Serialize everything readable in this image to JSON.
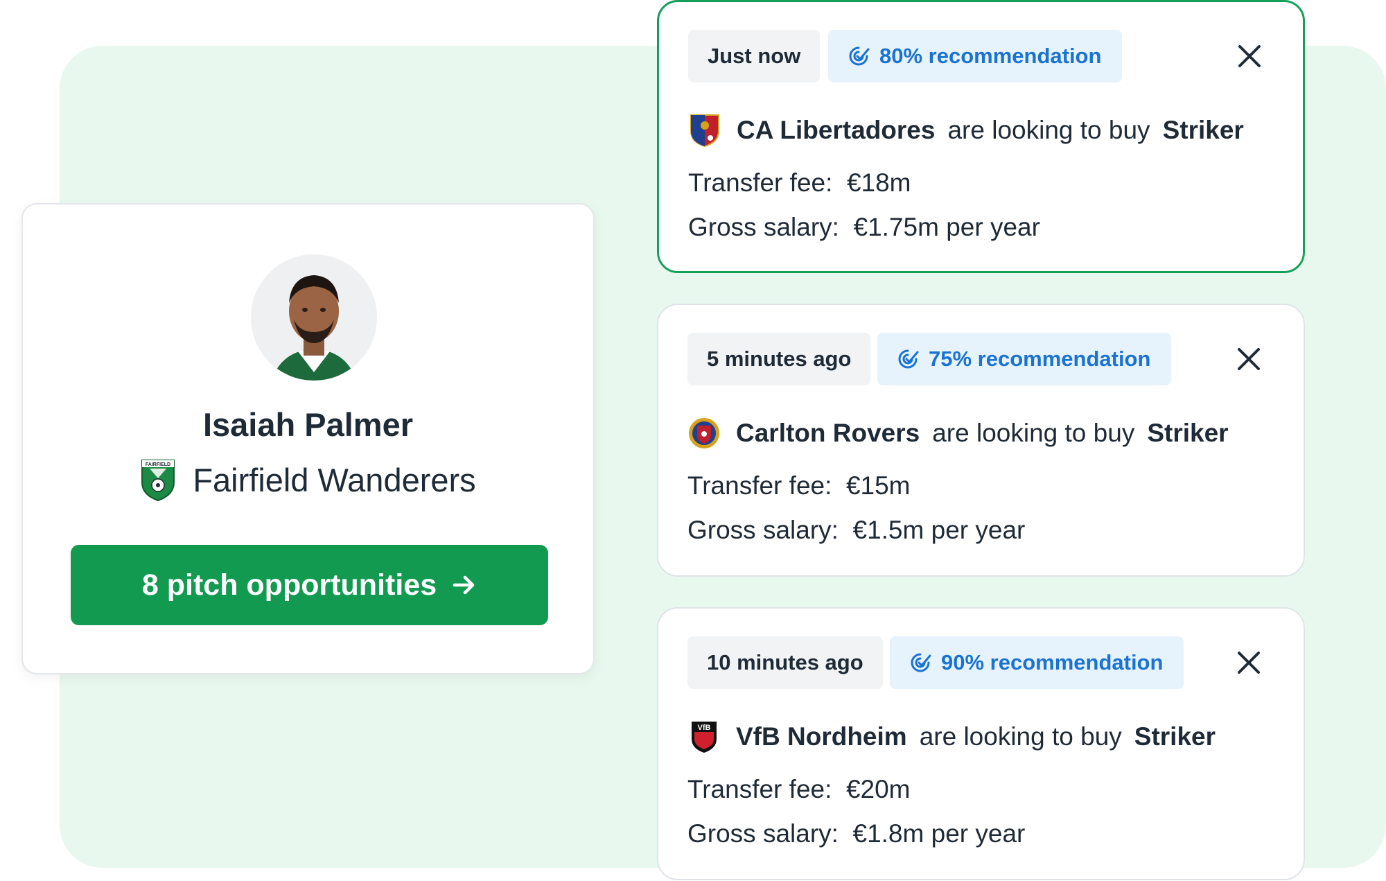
{
  "player": {
    "name": "Isaiah Palmer",
    "club": "Fairfield Wanderers",
    "crest_text": "FAIRFIELD",
    "cta_label": "8 pitch opportunities"
  },
  "opportunities": [
    {
      "time": "Just now",
      "recommendation": "80% recommendation",
      "team": "CA Libertadores",
      "verb": "are looking to buy",
      "position": "Striker",
      "fee_label": "Transfer fee:",
      "fee": "€18m",
      "salary_label": "Gross salary:",
      "salary": "€1.75m per year",
      "active": true
    },
    {
      "time": "5 minutes ago",
      "recommendation": "75% recommendation",
      "team": "Carlton Rovers",
      "verb": "are looking to buy",
      "position": "Striker",
      "fee_label": "Transfer fee:",
      "fee": "€15m",
      "salary_label": "Gross salary:",
      "salary": "€1.5m per year",
      "active": false
    },
    {
      "time": "10 minutes ago",
      "recommendation": "90% recommendation",
      "team": "VfB Nordheim",
      "verb": "are looking to buy",
      "position": "Striker",
      "fee_label": "Transfer fee:",
      "fee": "€20m",
      "salary_label": "Gross salary:",
      "salary": "€1.8m per year",
      "active": false,
      "crest_text": "VfB"
    }
  ],
  "colors": {
    "primary_green": "#119a50",
    "active_border": "#15a05a",
    "recommendation_blue": "#1a73d1",
    "background_panel": "#e8f8ee"
  },
  "icons": {
    "recommendation": "target-check-icon",
    "close": "close-icon",
    "cta": "arrow-right-icon"
  }
}
